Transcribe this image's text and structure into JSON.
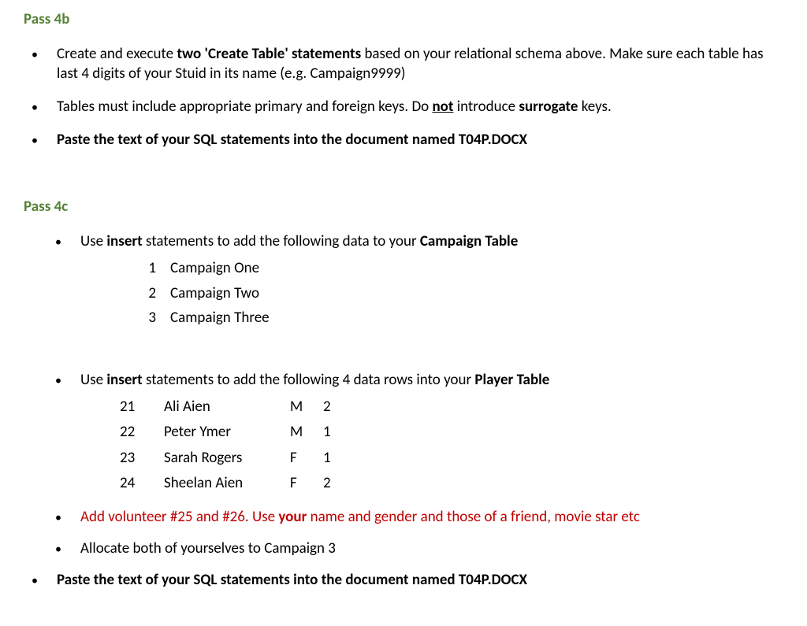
{
  "section4b": {
    "heading": "Pass 4b",
    "items": [
      {
        "pre1": "Create and execute ",
        "bold1": "two 'Create Table' statements",
        "post1": " based on your relational schema above. Make sure each table has last 4 digits of your Stuid in its name (e.g. Campaign9999)"
      },
      {
        "pre1": "Tables must include appropriate primary and foreign keys. Do ",
        "boldU": "not",
        "mid1": " introduce ",
        "bold2": "surrogate",
        "post1": " keys."
      },
      {
        "fullBold": "Paste the text of your SQL statements into the document named T04P.DOCX"
      }
    ]
  },
  "section4c": {
    "heading": "Pass 4c",
    "item1": {
      "pre1": "Use ",
      "bold1": "insert",
      "mid1": " statements to add the following data to your ",
      "bold2": "Campaign Table"
    },
    "campaigns": [
      {
        "id": "1",
        "name": "Campaign One"
      },
      {
        "id": "2",
        "name": "Campaign Two"
      },
      {
        "id": "3",
        "name": "Campaign Three"
      }
    ],
    "item2": {
      "pre1": "Use ",
      "bold1": "insert",
      "mid1": " statements to add the following 4 data rows into your ",
      "bold2": "Player Table"
    },
    "players": [
      {
        "id": "21",
        "name": "Ali Aien",
        "g": "M",
        "c": "2"
      },
      {
        "id": "22",
        "name": "Peter Ymer",
        "g": "M",
        "c": "1"
      },
      {
        "id": "23",
        "name": "Sarah Rogers",
        "g": "F",
        "c": "1"
      },
      {
        "id": "24",
        "name": "Sheelan Aien",
        "g": "F",
        "c": "2"
      }
    ],
    "item3": {
      "pre1": "Add volunteer #25 and #26. Use ",
      "bold1": "your",
      "post1": " name and gender and those of a friend, movie star etc"
    },
    "item4": {
      "text": "Allocate both of yourselves to Campaign 3"
    },
    "item5": {
      "fullBold": "Paste the text of your SQL statements into the document named T04P.DOCX"
    }
  }
}
